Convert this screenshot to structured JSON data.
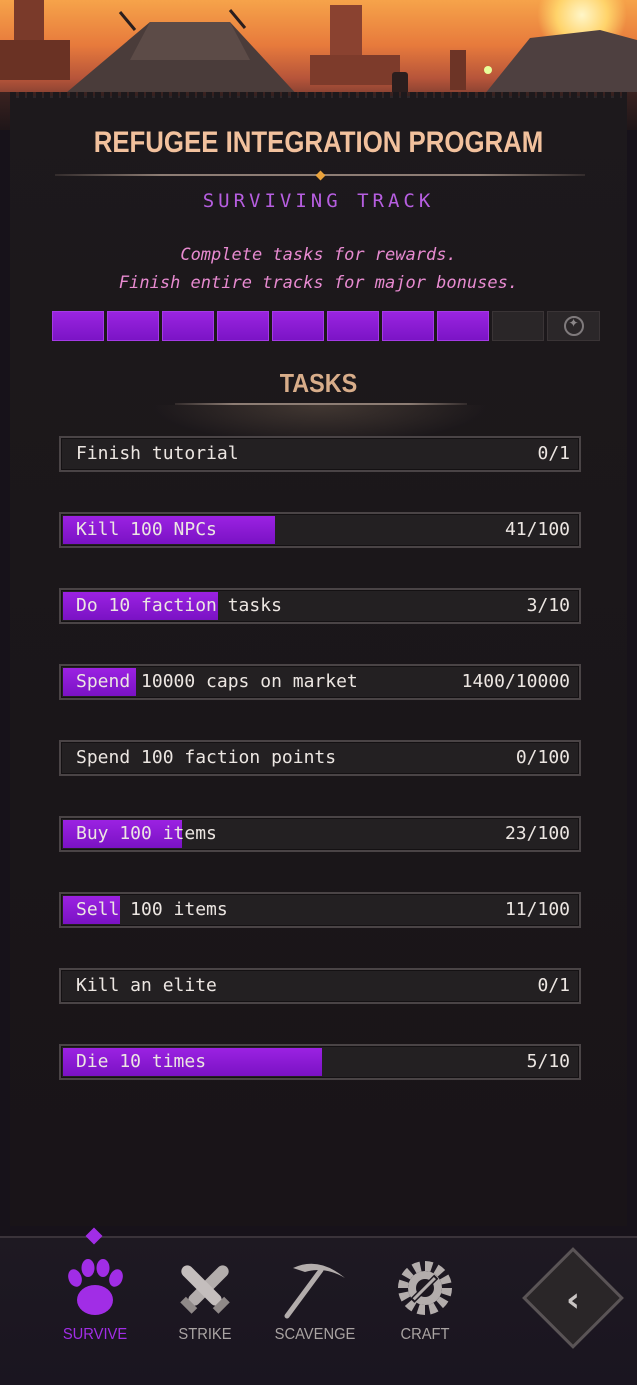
{
  "header": {
    "title": "REFUGEE INTEGRATION PROGRAM",
    "track_name": "SURVIVING TRACK",
    "description_line1": "Complete tasks for rewards.",
    "description_line2": "Finish entire tracks for major bonuses."
  },
  "track_progress": {
    "segments_total": 9,
    "segments_filled": 8,
    "reward_icon": "star-compass-icon"
  },
  "tasks_heading": "TASKS",
  "tasks": [
    {
      "label": "Finish tutorial",
      "count": "0/1",
      "progress": 0.0
    },
    {
      "label": "Kill 100 NPCs",
      "count": "41/100",
      "progress": 0.41
    },
    {
      "label": "Do 10 faction tasks",
      "count": "3/10",
      "progress": 0.3
    },
    {
      "label": "Spend 10000 caps on market",
      "count": "1400/10000",
      "progress": 0.14
    },
    {
      "label": "Spend 100 faction points",
      "count": "0/100",
      "progress": 0.0
    },
    {
      "label": "Buy 100 items",
      "count": "23/100",
      "progress": 0.23
    },
    {
      "label": "Sell 100 items",
      "count": "11/100",
      "progress": 0.11
    },
    {
      "label": "Kill an elite",
      "count": "0/1",
      "progress": 0.0
    },
    {
      "label": "Die 10 times",
      "count": "5/10",
      "progress": 0.5
    }
  ],
  "nav": {
    "items": [
      {
        "label": "SURVIVE",
        "icon": "paw-icon",
        "active": true
      },
      {
        "label": "STRIKE",
        "icon": "crossed-bullets-icon",
        "active": false
      },
      {
        "label": "SCAVENGE",
        "icon": "pickaxe-icon",
        "active": false
      },
      {
        "label": "CRAFT",
        "icon": "gear-wrench-icon",
        "active": false
      }
    ],
    "back_icon": "chevron-left-icon"
  },
  "colors": {
    "accent_purple": "#9b22e2",
    "title_peach": "#f2c19d",
    "track_purple": "#b65ee0",
    "description_pink": "#e78ad0"
  }
}
